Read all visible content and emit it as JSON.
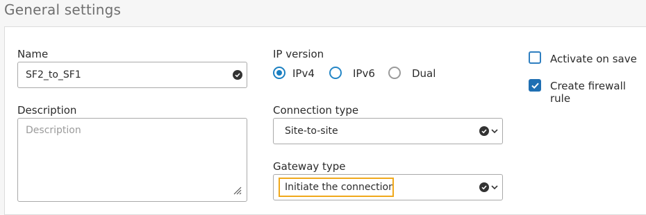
{
  "section": {
    "title": "General settings"
  },
  "name_field": {
    "label": "Name",
    "value": "SF2_to_SF1"
  },
  "description_field": {
    "label": "Description",
    "placeholder": "Description"
  },
  "ip_version": {
    "label": "IP version",
    "options": [
      {
        "label": "IPv4",
        "selected": true
      },
      {
        "label": "IPv6",
        "selected": false
      },
      {
        "label": "Dual",
        "selected": false
      }
    ]
  },
  "connection_type": {
    "label": "Connection type",
    "value": "Site-to-site"
  },
  "gateway_type": {
    "label": "Gateway type",
    "value": "Initiate the connection"
  },
  "options": {
    "activate_on_save": {
      "label": "Activate on save",
      "checked": false
    },
    "create_firewall_rule": {
      "label": "Create firewall rule",
      "checked": true
    }
  },
  "colors": {
    "accent": "#1a7fc1",
    "highlight": "#f0a81a"
  },
  "icons": {
    "field_status": "check-circle-icon",
    "dropdown": "chevron-down-icon",
    "resize": "resize-grip-icon"
  }
}
